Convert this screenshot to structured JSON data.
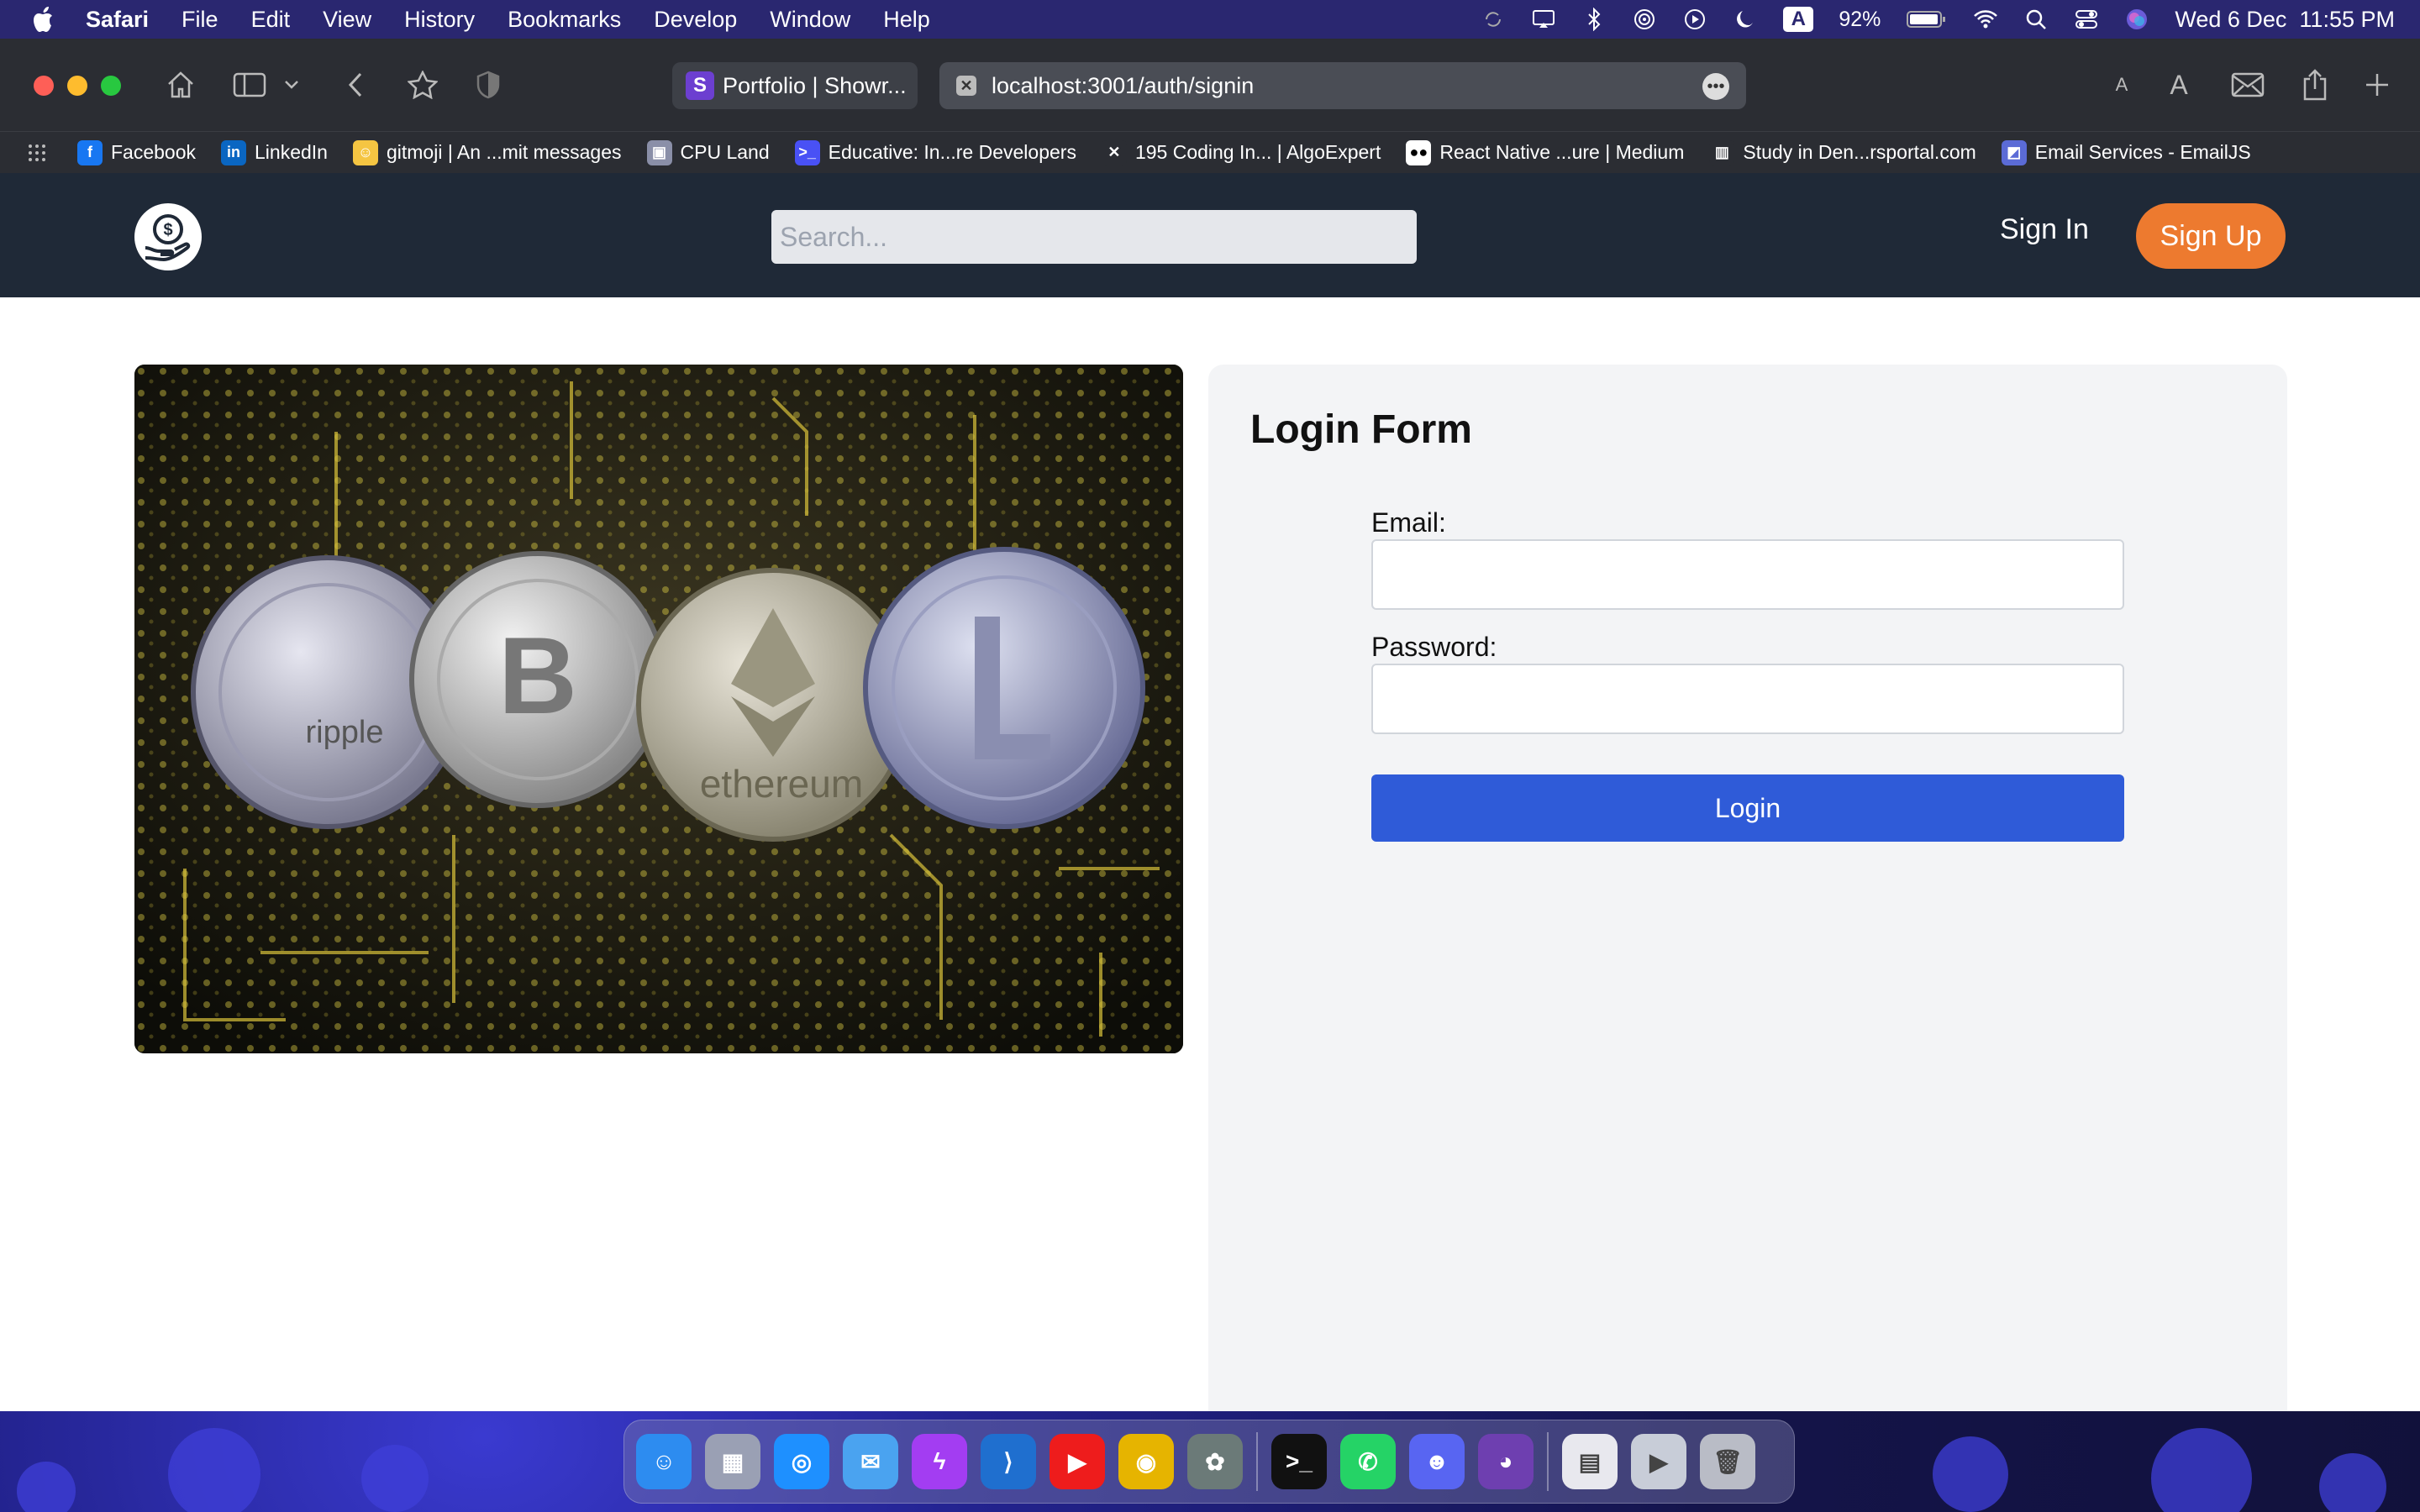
{
  "menubar": {
    "app_name": "Safari",
    "items": [
      "File",
      "Edit",
      "View",
      "History",
      "Bookmarks",
      "Develop",
      "Window",
      "Help"
    ],
    "battery": "92%",
    "input_source": "A",
    "clock": "Wed 6 Dec  11:55 PM"
  },
  "browser": {
    "tab_title": "Portfolio | Showr...",
    "address": "localhost:3001/auth/signin",
    "bookmarks": [
      {
        "label": "Facebook",
        "icon": "facebook-icon",
        "color": "#1877f2",
        "glyph": "f"
      },
      {
        "label": "LinkedIn",
        "icon": "linkedin-icon",
        "color": "#0a66c2",
        "glyph": "in"
      },
      {
        "label": "gitmoji | An ...mit messages",
        "icon": "gitmoji-icon",
        "color": "#f5c542",
        "glyph": "☺"
      },
      {
        "label": "CPU Land",
        "icon": "cpu-land-icon",
        "color": "#8a8fa8",
        "glyph": "▣"
      },
      {
        "label": "Educative: In...re Developers",
        "icon": "educative-icon",
        "color": "#4951f5",
        "glyph": ">_"
      },
      {
        "label": "195 Coding In... | AlgoExpert",
        "icon": "algoexpert-icon",
        "color": "#2b2d33",
        "glyph": "✕"
      },
      {
        "label": "React Native ...ure | Medium",
        "icon": "medium-icon",
        "color": "#ffffff",
        "glyph": "●●"
      },
      {
        "label": "Study in Den...rsportal.com",
        "icon": "study-portal-icon",
        "color": "#2b2d33",
        "glyph": "▥"
      },
      {
        "label": "Email Services - EmailJS",
        "icon": "emailjs-icon",
        "color": "#5b6bd6",
        "glyph": "◩"
      }
    ]
  },
  "site": {
    "search_placeholder": "Search...",
    "sign_in": "Sign In",
    "sign_up": "Sign Up"
  },
  "login": {
    "title": "Login Form",
    "email_label": "Email:",
    "password_label": "Password:",
    "button": "Login"
  },
  "dock": [
    {
      "name": "finder",
      "color": "#2d8cf0",
      "glyph": "☺"
    },
    {
      "name": "launchpad",
      "color": "#9aa0b4",
      "glyph": "▦"
    },
    {
      "name": "safari",
      "color": "#1e90ff",
      "glyph": "◎"
    },
    {
      "name": "mail",
      "color": "#4aa3f0",
      "glyph": "✉"
    },
    {
      "name": "messenger",
      "color": "#a33df2",
      "glyph": "ϟ"
    },
    {
      "name": "vscode",
      "color": "#1f6fcf",
      "glyph": "⟩"
    },
    {
      "name": "youtube",
      "color": "#ee1c1c",
      "glyph": "▶"
    },
    {
      "name": "chrome",
      "color": "#e6b400",
      "glyph": "◉"
    },
    {
      "name": "chatgpt",
      "color": "#6b7a78",
      "glyph": "✿"
    },
    {
      "sep": true
    },
    {
      "name": "terminal",
      "color": "#111111",
      "glyph": ">_"
    },
    {
      "name": "whatsapp",
      "color": "#25d366",
      "glyph": "✆"
    },
    {
      "name": "discord",
      "color": "#5865f2",
      "glyph": "☻"
    },
    {
      "name": "github-desktop",
      "color": "#6e3fb0",
      "glyph": "◕"
    },
    {
      "sep": true
    },
    {
      "name": "documents",
      "color": "#e8e8ee",
      "glyph": "▤"
    },
    {
      "name": "video-thumbnail",
      "color": "#c8cdd8",
      "glyph": "▶"
    },
    {
      "name": "trash",
      "color": "#b9bcc6",
      "glyph": "🗑"
    }
  ]
}
